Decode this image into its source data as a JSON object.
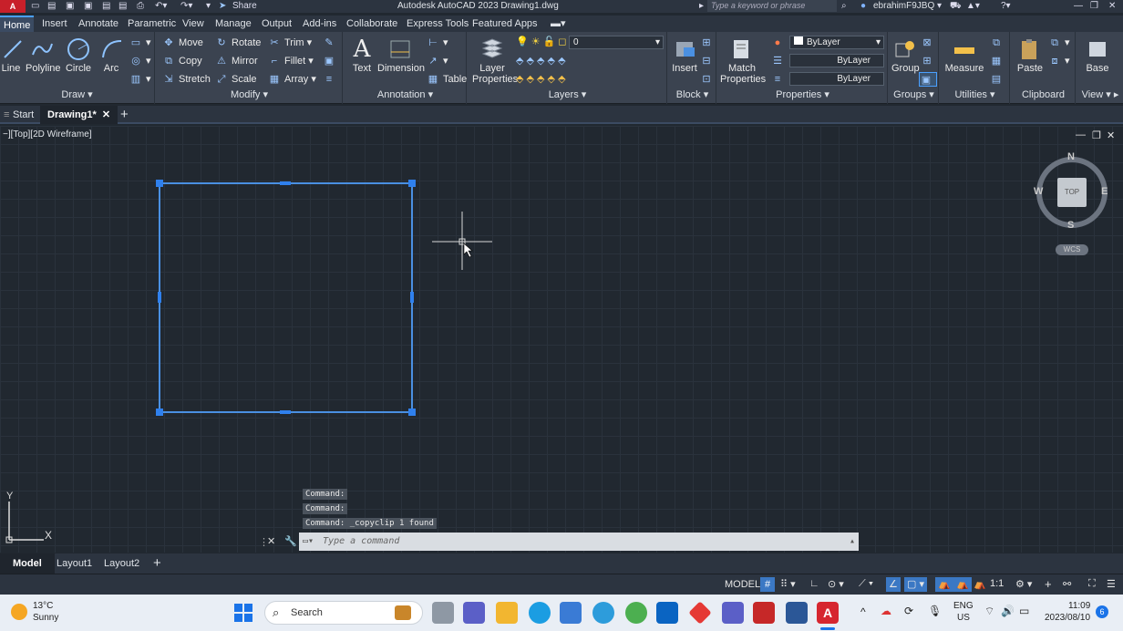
{
  "window": {
    "title": "Autodesk AutoCAD 2023   Drawing1.dwg",
    "logo": "A CAD",
    "share": "Share",
    "search_placeholder": "Type a keyword or phrase",
    "user": "ebrahimF9JBQ"
  },
  "menu": {
    "tabs": [
      "Home",
      "Insert",
      "Annotate",
      "Parametric",
      "View",
      "Manage",
      "Output",
      "Add-ins",
      "Collaborate",
      "Express Tools",
      "Featured Apps"
    ]
  },
  "ribbon": {
    "draw": {
      "title": "Draw",
      "line": "Line",
      "polyline": "Polyline",
      "circle": "Circle",
      "arc": "Arc"
    },
    "modify": {
      "title": "Modify",
      "move": "Move",
      "rotate": "Rotate",
      "trim": "Trim",
      "copy": "Copy",
      "mirror": "Mirror",
      "fillet": "Fillet",
      "stretch": "Stretch",
      "scale": "Scale",
      "array": "Array"
    },
    "annotation": {
      "title": "Annotation",
      "text": "Text",
      "dimension": "Dimension",
      "table": "Table"
    },
    "layers": {
      "title": "Layers",
      "layer_properties_1": "Layer",
      "layer_properties_2": "Properties",
      "current_layer": "0"
    },
    "block": {
      "title": "Block",
      "insert": "Insert"
    },
    "properties": {
      "title": "Properties",
      "match_1": "Match",
      "match_2": "Properties",
      "color": "ByLayer",
      "linetype": "ByLayer",
      "lineweight": "ByLayer"
    },
    "groups": {
      "title": "Groups",
      "group": "Group"
    },
    "utilities": {
      "title": "Utilities",
      "measure": "Measure"
    },
    "clipboard": {
      "title": "Clipboard",
      "paste": "Paste"
    },
    "view": {
      "title": "View",
      "base": "Base"
    }
  },
  "doctabs": {
    "start": "Start",
    "drawing": "Drawing1*"
  },
  "viewport": {
    "label": "−][Top][2D Wireframe]",
    "compass": {
      "n": "N",
      "s": "S",
      "e": "E",
      "w": "W",
      "top": "TOP",
      "wcs": "WCS"
    },
    "ucs": {
      "x": "X",
      "y": "Y"
    }
  },
  "command": {
    "history": [
      "Command:",
      "Command:",
      "Command: _copyclip 1 found"
    ],
    "placeholder": "Type a command"
  },
  "layouts": {
    "model": "Model",
    "layout1": "Layout1",
    "layout2": "Layout2"
  },
  "status": {
    "model": "MODEL",
    "scale": "1:1"
  },
  "taskbar": {
    "weather_temp": "13°C",
    "weather_desc": "Sunny",
    "search": "Search",
    "lang_1": "ENG",
    "lang_2": "US",
    "time": "11:09",
    "date": "2023/08/10",
    "notif": "6"
  },
  "colors": {
    "accent": "#4a90e2",
    "selection": "#2f80ed",
    "canvas": "#212830",
    "ribbon": "#3b4350"
  }
}
